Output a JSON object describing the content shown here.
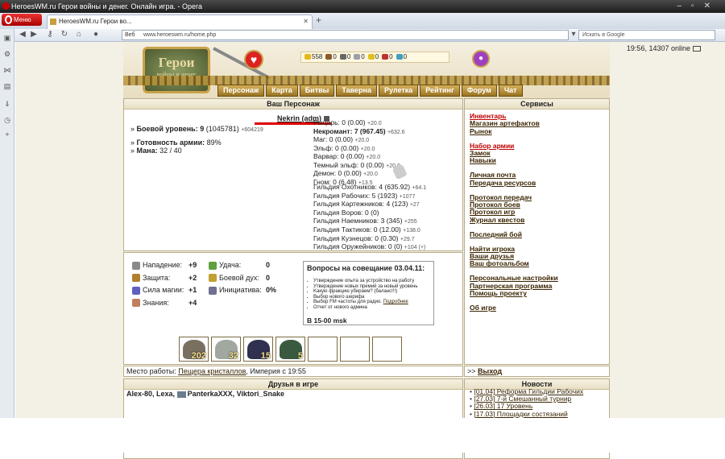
{
  "window": {
    "title": "HeroesWM.ru Герои войны и денег. Онлайн игра. - Opera"
  },
  "browser": {
    "menu_label": "Меню",
    "tab_title": "HeroesWM.ru Герои во...",
    "web_label": "Веб",
    "url": "www.heroeswm.ru/home.php",
    "search_placeholder": "Искать в Google"
  },
  "header": {
    "clock": "19:56, 14307 online",
    "logo_line1": "Герои",
    "logo_line2": "войны и денег",
    "resources": [
      {
        "icon": "gold-icon",
        "value": "558",
        "color": "#e6b820"
      },
      {
        "icon": "wood-icon",
        "value": "0",
        "color": "#8a5a2a"
      },
      {
        "icon": "ore-icon",
        "value": "0",
        "color": "#666666"
      },
      {
        "icon": "mercury-icon",
        "value": "0",
        "color": "#9aa0a8"
      },
      {
        "icon": "sulfur-icon",
        "value": "0",
        "color": "#e0c020"
      },
      {
        "icon": "crystal-icon",
        "value": "0",
        "color": "#c03030"
      },
      {
        "icon": "gems-icon",
        "value": "0",
        "color": "#40a0c0"
      }
    ],
    "menu": [
      "Персонаж",
      "Карта",
      "Битвы",
      "Таверна",
      "Рулетка",
      "Рейтинг",
      "Форум",
      "Чат"
    ]
  },
  "character": {
    "panel_title": "Ваш Персонаж",
    "nick": "Nekrin (adm)",
    "combat_level_label": "Боевой уровень:",
    "combat_level": "9",
    "combat_exp": "(1045781)",
    "combat_exp_delta": "+604219",
    "army_ready_label": "Готовность армии:",
    "army_ready": "89%",
    "mana_label": "Мана:",
    "mana": "32 / 40",
    "skills": [
      {
        "name": "Рыцарь:",
        "value": "0 (0.00)",
        "delta": "+20.0",
        "bold": false
      },
      {
        "name": "Некромант:",
        "value": "7 (967.45)",
        "delta": "+632.6",
        "bold": true
      },
      {
        "name": "Маг:",
        "value": "0 (0.00)",
        "delta": "+20.0",
        "bold": false
      },
      {
        "name": "Эльф:",
        "value": "0 (0.00)",
        "delta": "+20.0",
        "bold": false
      },
      {
        "name": "Варвар:",
        "value": "0 (0.00)",
        "delta": "+20.0",
        "bold": false
      },
      {
        "name": "Темный эльф:",
        "value": "0 (0.00)",
        "delta": "+20.0",
        "bold": false
      },
      {
        "name": "Демон:",
        "value": "0 (0.00)",
        "delta": "+20.0",
        "bold": false
      },
      {
        "name": "Гном:",
        "value": "0 (6.48)",
        "delta": "+13.5",
        "bold": false
      }
    ],
    "guilds": [
      {
        "name": "Гильдия Охотников:",
        "value": "4 (635.92)",
        "delta": "+64.1"
      },
      {
        "name": "Гильдия Рабочих:",
        "value": "5 (1923)",
        "delta": "+1077"
      },
      {
        "name": "Гильдия Картежников:",
        "value": "4 (123)",
        "delta": "+27"
      },
      {
        "name": "Гильдия Воров:",
        "value": "0 (0)",
        "delta": ""
      },
      {
        "name": "Гильдия Наемников:",
        "value": "3 (345)",
        "delta": "+255"
      },
      {
        "name": "Гильдия Тактиков:",
        "value": "0 (12.00)",
        "delta": "+138.0"
      },
      {
        "name": "Гильдия Кузнецов:",
        "value": "0 (0.30)",
        "delta": "+29.7"
      },
      {
        "name": "Гильдия Оружейников:",
        "value": "0 (0)",
        "delta": "+104 (+)"
      }
    ]
  },
  "attributes": {
    "left": [
      {
        "icon": "attack-icon",
        "label": "Нападение:",
        "value": "+9",
        "color": "#8a8a8a"
      },
      {
        "icon": "defense-icon",
        "label": "Защита:",
        "value": "+2",
        "color": "#b08030"
      },
      {
        "icon": "magic-power-icon",
        "label": "Сила магии:",
        "value": "+1",
        "color": "#6060c0"
      },
      {
        "icon": "knowledge-icon",
        "label": "Знания:",
        "value": "+4",
        "color": "#c08060"
      }
    ],
    "right": [
      {
        "icon": "luck-icon",
        "label": "Удача:",
        "value": "0",
        "color": "#60a040"
      },
      {
        "icon": "morale-icon",
        "label": "Боевой дух:",
        "value": "0",
        "color": "#c0a030"
      },
      {
        "icon": "initiative-icon",
        "label": "Инициатива:",
        "value": "0%",
        "color": "#707090"
      }
    ]
  },
  "meeting": {
    "title": "Вопросы на совещание 03.04.11:",
    "items": [
      "Утверждение опыта за устройство на работу",
      "Утверждение новых премий за новый уровень",
      "Kaкую фракцию убираем? (баланс!!!)",
      "Выбор нового шерифа",
      "Выбор FM частоты для радио.",
      "Отчет от нового админа"
    ],
    "details_link": "Подробнее",
    "time": "В 15-00 msk"
  },
  "army": [
    {
      "name": "unit-skeleton-icon",
      "count": "202",
      "color": "#7a7060"
    },
    {
      "name": "unit-zombie-icon",
      "count": "32",
      "color": "#a0a8a0"
    },
    {
      "name": "unit-vampire-icon",
      "count": "15",
      "color": "#303050"
    },
    {
      "name": "unit-lich-icon",
      "count": "5",
      "color": "#3a5a40"
    }
  ],
  "workplace": {
    "label": "Место работы:",
    "place": "Пещера кристаллов",
    "rest": ", Империя с 19:55"
  },
  "exit": {
    "prefix": ">>",
    "link": "Выход"
  },
  "friends": {
    "title": "Друзья в игре",
    "list_a": "Alex-80, Lexa,",
    "list_b": "PanterkaXXX, Viktori_Snake"
  },
  "services": {
    "title": "Сервисы",
    "groups": [
      [
        "Инвентарь",
        "Магазин артефактов",
        "Рынок"
      ],
      [
        "Набор армии",
        "Замок",
        "Навыки"
      ],
      [
        "Личная почта",
        "Передача ресурсов"
      ],
      [
        "Протокол передач",
        "Протокол боев",
        "Протокол игр",
        "Журнал квестов"
      ],
      [
        "Последний бой"
      ],
      [
        "Найти игрока",
        "Ваши друзья",
        "Ваш фотоальбом"
      ],
      [
        "Персональные настройки",
        "Партнерская программа",
        "Помощь проекту"
      ],
      [
        "Об игре"
      ]
    ],
    "highlight_color": "#c00000"
  },
  "news": {
    "title": "Новости",
    "items": [
      {
        "date": "[01.04]",
        "text": "Реформа Гильдии Рабочих"
      },
      {
        "date": "[27.03]",
        "text": "7-й Смешанный турнир"
      },
      {
        "date": "[26.03]",
        "text": "17 Уровень"
      },
      {
        "date": "[17.03]",
        "text": "Площадки состязаний"
      }
    ]
  }
}
